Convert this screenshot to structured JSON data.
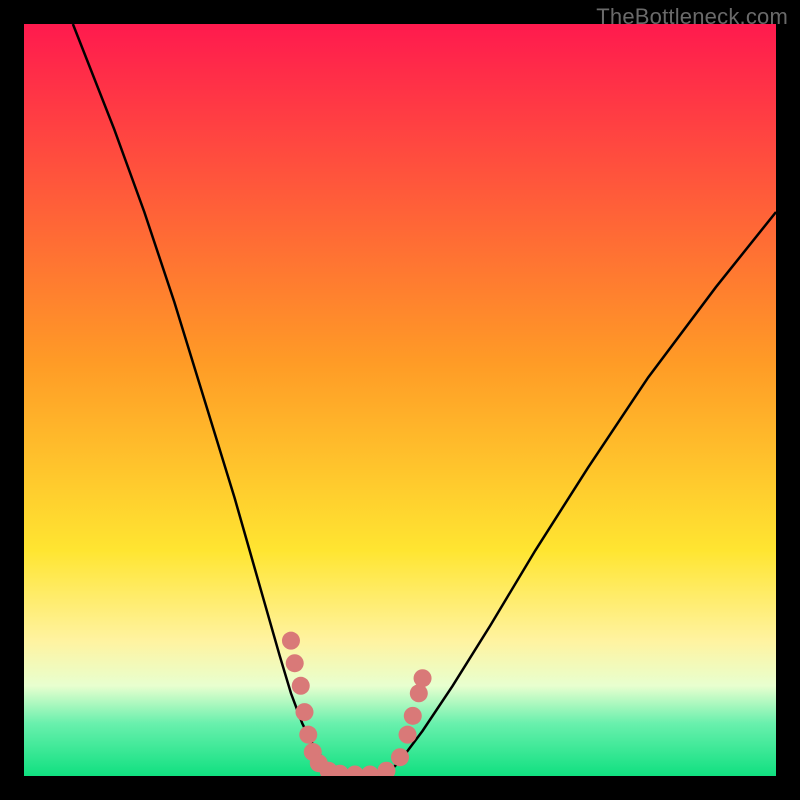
{
  "watermark": {
    "text": "TheBottleneck.com"
  },
  "colors": {
    "black": "#000000",
    "curve": "#000000",
    "marker_fill": "#d97978",
    "marker_stroke": "#8e3a39"
  },
  "chart_data": {
    "type": "line",
    "title": "",
    "xlabel": "",
    "ylabel": "",
    "xlim": [
      0,
      100
    ],
    "ylim": [
      0,
      100
    ],
    "background_gradient": [
      {
        "stop": 0.0,
        "color": "#ff1a4e"
      },
      {
        "stop": 0.45,
        "color": "#ff9b26"
      },
      {
        "stop": 0.7,
        "color": "#ffe531"
      },
      {
        "stop": 0.82,
        "color": "#fff3a0"
      },
      {
        "stop": 0.88,
        "color": "#e8ffcf"
      },
      {
        "stop": 0.93,
        "color": "#69f0ad"
      },
      {
        "stop": 1.0,
        "color": "#10e080"
      }
    ],
    "series": [
      {
        "name": "left-curve",
        "x": [
          6.5,
          12,
          16,
          20,
          24,
          28,
          30,
          32,
          34,
          35.5,
          37,
          38.5,
          40,
          41,
          42
        ],
        "y": [
          100,
          86,
          75,
          63,
          50,
          37,
          30,
          23,
          16,
          11,
          7,
          4,
          2,
          1,
          0
        ]
      },
      {
        "name": "right-curve",
        "x": [
          48,
          50,
          53,
          57,
          62,
          68,
          75,
          83,
          92,
          100
        ],
        "y": [
          0,
          2,
          6,
          12,
          20,
          30,
          41,
          53,
          65,
          75
        ]
      }
    ],
    "markers": {
      "name": "bottleneck-points",
      "points": [
        {
          "x": 35.5,
          "y": 18
        },
        {
          "x": 36.0,
          "y": 15
        },
        {
          "x": 36.8,
          "y": 12
        },
        {
          "x": 37.3,
          "y": 8.5
        },
        {
          "x": 37.8,
          "y": 5.5
        },
        {
          "x": 38.4,
          "y": 3.2
        },
        {
          "x": 39.2,
          "y": 1.7
        },
        {
          "x": 40.5,
          "y": 0.7
        },
        {
          "x": 42.0,
          "y": 0.3
        },
        {
          "x": 44.0,
          "y": 0.2
        },
        {
          "x": 46.0,
          "y": 0.2
        },
        {
          "x": 48.2,
          "y": 0.7
        },
        {
          "x": 50.0,
          "y": 2.5
        },
        {
          "x": 51.0,
          "y": 5.5
        },
        {
          "x": 51.7,
          "y": 8.0
        },
        {
          "x": 52.5,
          "y": 11.0
        },
        {
          "x": 53.0,
          "y": 13.0
        }
      ]
    }
  }
}
